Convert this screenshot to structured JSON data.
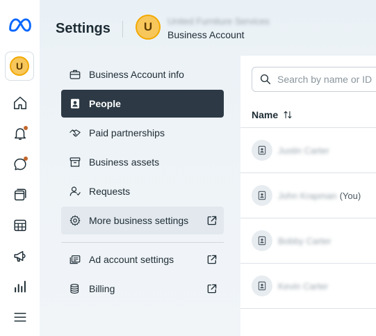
{
  "rail": {
    "logo": "meta-logo",
    "avatar_letter": "U",
    "items": [
      {
        "name": "home-icon"
      },
      {
        "name": "bell-icon",
        "badge": true
      },
      {
        "name": "chat-bubble-icon",
        "badge": true
      },
      {
        "name": "layers-icon"
      },
      {
        "name": "table-icon"
      },
      {
        "name": "megaphone-icon"
      },
      {
        "name": "bar-chart-icon"
      },
      {
        "name": "hamburger-menu-icon"
      }
    ]
  },
  "header": {
    "title": "Settings",
    "avatar_letter": "U",
    "account_name": "United Furniture Services",
    "account_type": "Business Account"
  },
  "menu": {
    "items": [
      {
        "label": "Business Account info",
        "icon": "briefcase-icon"
      },
      {
        "label": "People",
        "icon": "id-badge-icon",
        "active": true
      },
      {
        "label": "Paid partnerships",
        "icon": "handshake-icon"
      },
      {
        "label": "Business assets",
        "icon": "archive-box-icon"
      },
      {
        "label": "Requests",
        "icon": "person-request-icon"
      },
      {
        "label": "More business settings",
        "icon": "gear-icon",
        "external": true
      },
      {
        "label": "Ad account settings",
        "icon": "ad-account-icon",
        "external": true
      },
      {
        "label": "Billing",
        "icon": "billing-stack-icon",
        "external": true
      }
    ]
  },
  "content": {
    "search_placeholder": "Search by name or ID",
    "column_name": "Name",
    "people": [
      {
        "name": "Justin Carter",
        "suffix": ""
      },
      {
        "name": "John Krapman",
        "suffix": "(You)"
      },
      {
        "name": "Bobby Carter",
        "suffix": ""
      },
      {
        "name": "Kevin Carter",
        "suffix": ""
      }
    ]
  },
  "colors": {
    "accent_dark": "#2d3a45",
    "badge": "#c2662b",
    "avatar": "#f7c75c",
    "meta_blue": "#0866ff"
  }
}
